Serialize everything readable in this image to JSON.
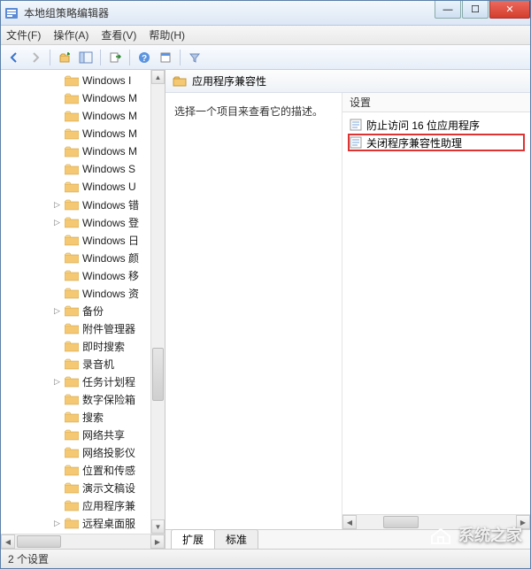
{
  "window": {
    "title": "本地组策略编辑器"
  },
  "menu": {
    "file": "文件(F)",
    "action": "操作(A)",
    "view": "查看(V)",
    "help": "帮助(H)"
  },
  "toolbar_icons": [
    "back",
    "forward",
    "up",
    "show-hide-tree",
    "export",
    "refresh",
    "help",
    "filter"
  ],
  "tree": {
    "items": [
      {
        "exp": "",
        "label": "Windows I",
        "indent": 1
      },
      {
        "exp": "",
        "label": "Windows M",
        "indent": 1
      },
      {
        "exp": "",
        "label": "Windows M",
        "indent": 1
      },
      {
        "exp": "",
        "label": "Windows M",
        "indent": 1
      },
      {
        "exp": "",
        "label": "Windows M",
        "indent": 1
      },
      {
        "exp": "",
        "label": "Windows S",
        "indent": 1
      },
      {
        "exp": "",
        "label": "Windows U",
        "indent": 1
      },
      {
        "exp": "▷",
        "label": "Windows 错",
        "indent": 1
      },
      {
        "exp": "▷",
        "label": "Windows 登",
        "indent": 1
      },
      {
        "exp": "",
        "label": "Windows 日",
        "indent": 1
      },
      {
        "exp": "",
        "label": "Windows 颜",
        "indent": 1
      },
      {
        "exp": "",
        "label": "Windows 移",
        "indent": 1
      },
      {
        "exp": "",
        "label": "Windows 资",
        "indent": 1
      },
      {
        "exp": "▷",
        "label": "备份",
        "indent": 1
      },
      {
        "exp": "",
        "label": "附件管理器",
        "indent": 1
      },
      {
        "exp": "",
        "label": "即时搜索",
        "indent": 1
      },
      {
        "exp": "",
        "label": "录音机",
        "indent": 1
      },
      {
        "exp": "▷",
        "label": "任务计划程",
        "indent": 1
      },
      {
        "exp": "",
        "label": "数字保险箱",
        "indent": 1
      },
      {
        "exp": "",
        "label": "搜索",
        "indent": 1
      },
      {
        "exp": "",
        "label": "网络共享",
        "indent": 1
      },
      {
        "exp": "",
        "label": "网络投影仪",
        "indent": 1
      },
      {
        "exp": "",
        "label": "位置和传感",
        "indent": 1
      },
      {
        "exp": "",
        "label": "演示文稿设",
        "indent": 1
      },
      {
        "exp": "",
        "label": "应用程序兼",
        "indent": 1
      },
      {
        "exp": "▷",
        "label": "远程桌面服",
        "indent": 1
      }
    ]
  },
  "right": {
    "header": "应用程序兼容性",
    "description": "选择一个项目来查看它的描述。",
    "settings_header": "设置",
    "items": [
      {
        "label": "防止访问 16 位应用程序",
        "highlight": false
      },
      {
        "label": "关闭程序兼容性助理",
        "highlight": true
      }
    ],
    "tabs": {
      "extended": "扩展",
      "standard": "标准"
    }
  },
  "status": "2 个设置",
  "watermark": "系统之家"
}
